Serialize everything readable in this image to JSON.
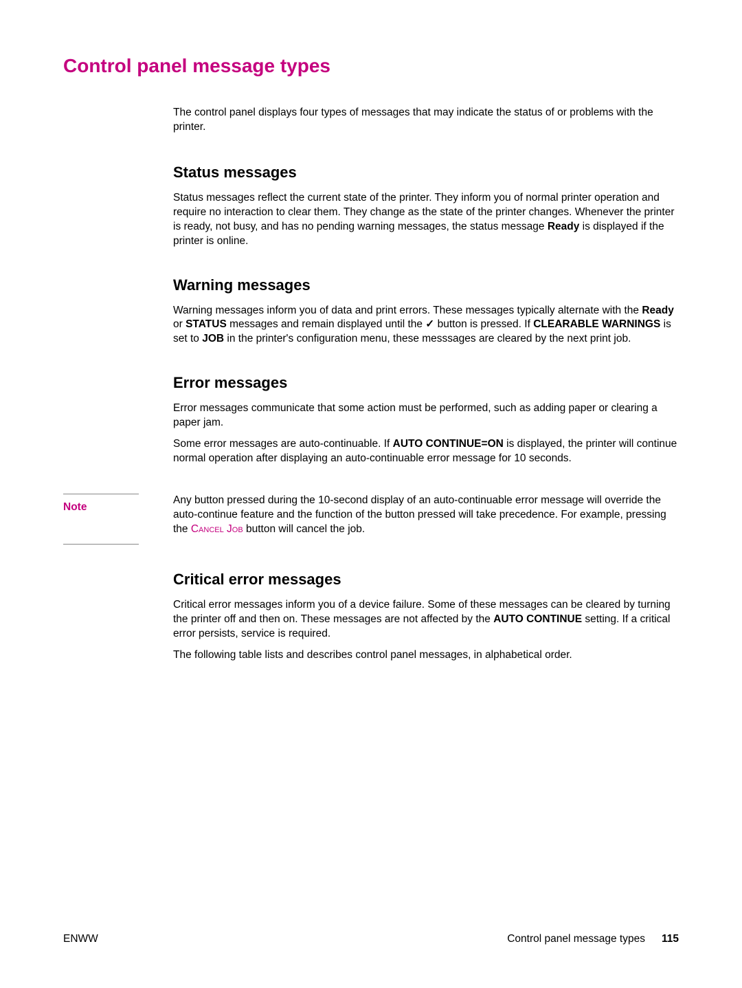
{
  "title": "Control panel message types",
  "intro": "The control panel displays four types of messages that may indicate the status of or problems with the printer.",
  "sections": {
    "status": {
      "heading": "Status messages",
      "p1a": "Status messages reflect the current state of the printer. They inform you of normal printer operation and require no interaction to clear them. They change as the state of the printer changes. Whenever the printer is ready, not busy, and has no pending warning messages, the status message ",
      "p1b": "Ready",
      "p1c": " is displayed if the printer is online."
    },
    "warning": {
      "heading": "Warning messages",
      "p1a": "Warning messages inform you of data and print errors. These messages typically alternate with the ",
      "p1b": "Ready",
      "p1c": " or ",
      "p1d": "STATUS",
      "p1e": " messages and remain displayed until the ",
      "p1f": "✓",
      "p1g": " button is pressed. If ",
      "p1h": "CLEARABLE WARNINGS",
      "p1i": " is set to ",
      "p1j": "JOB",
      "p1k": " in the printer's configuration menu, these messsages are cleared by the next print job."
    },
    "error": {
      "heading": "Error messages",
      "p1": "Error messages communicate that some action must be performed, such as adding paper or clearing a paper jam.",
      "p2a": "Some error messages are auto-continuable. If ",
      "p2b": "AUTO CONTINUE=ON",
      "p2c": " is displayed, the printer will continue normal operation after displaying an auto-continuable error message for 10 seconds."
    },
    "note": {
      "label": "Note",
      "p1a": "Any button pressed during the 10-second display of an auto-continuable error message will override the auto-continue feature and the function of the button pressed will take precedence. For example, pressing the ",
      "p1b": "Cancel Job",
      "p1c": " button will cancel the job."
    },
    "critical": {
      "heading": "Critical error messages",
      "p1a": "Critical error messages inform you of a device failure. Some of these messages can be cleared by turning the printer off and then on. These messages are not affected by the ",
      "p1b": "AUTO CONTINUE",
      "p1c": " setting. If a critical error persists, service is required.",
      "p2": "The following table lists and describes control panel messages, in alphabetical order."
    }
  },
  "footer": {
    "left": "ENWW",
    "right_text": "Control panel message types",
    "page_number": "115"
  }
}
